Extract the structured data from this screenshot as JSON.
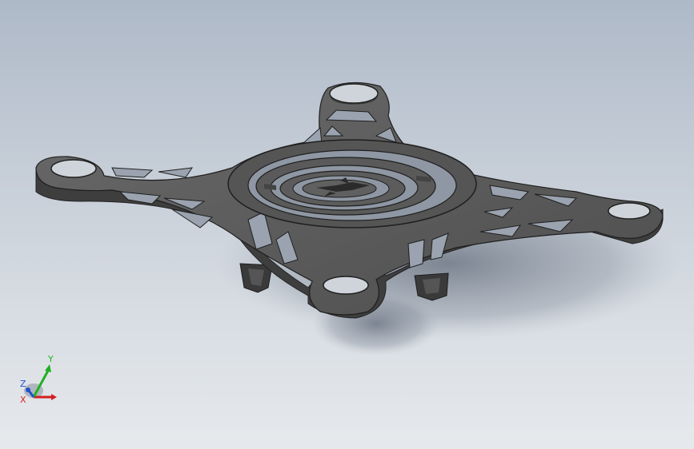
{
  "viewport": {
    "background_top": "#aeb9c8",
    "background_bottom": "#e6e9ec",
    "model_name": "quadcopter-frame"
  },
  "triad": {
    "x_label": "X",
    "y_label": "Y",
    "z_label": "Z",
    "x_color": "#d42020",
    "y_color": "#20b020",
    "z_color": "#2050d0"
  },
  "colors": {
    "frame_top": "#5a5a5a",
    "frame_side": "#3c3c3c",
    "frame_dark": "#2a2a2a",
    "shadow": "#7f8896"
  }
}
